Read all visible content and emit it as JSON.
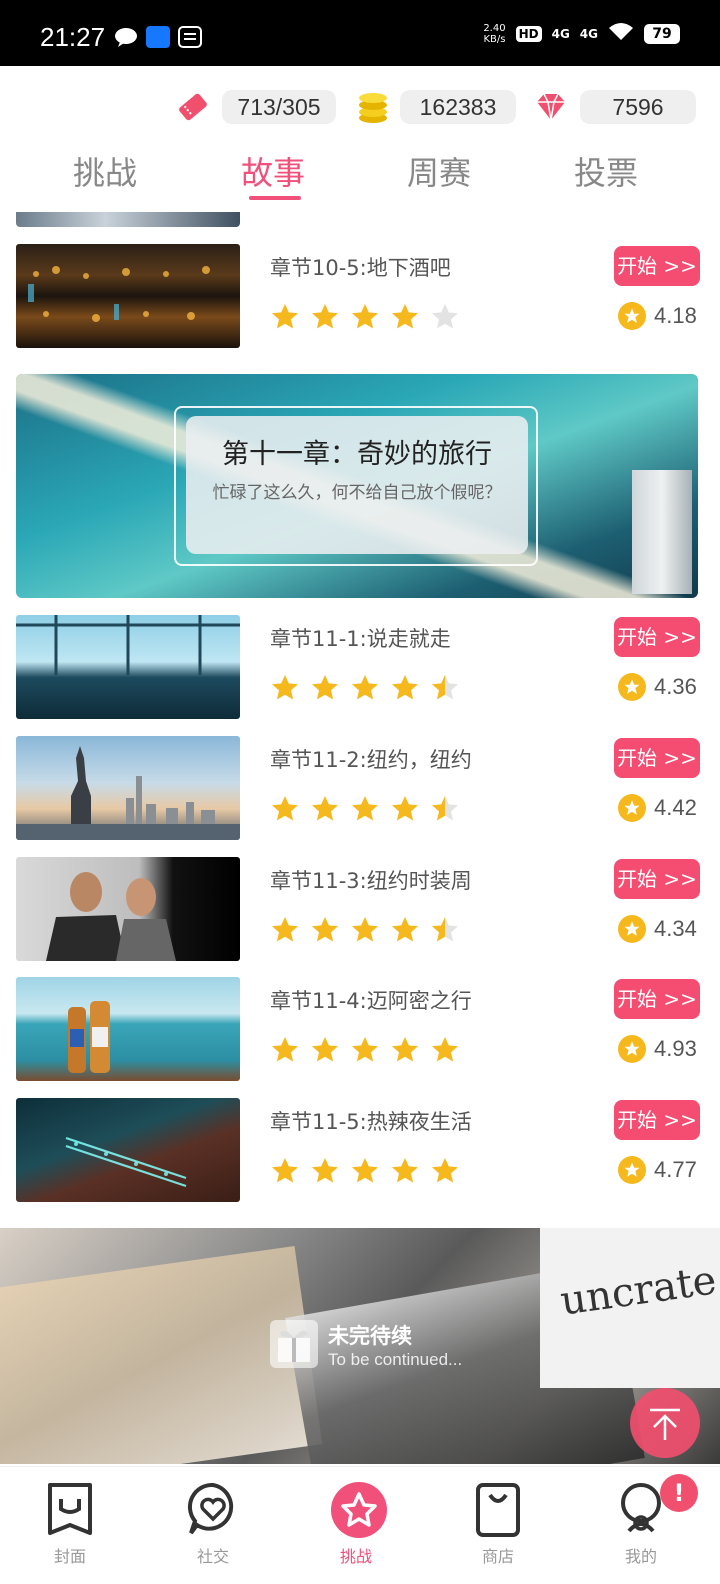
{
  "status_bar": {
    "time": "21:27",
    "net_speed_value": "2.40",
    "net_speed_unit": "KB/s",
    "hd_badge": "HD",
    "signal_1": "4G",
    "signal_2": "4G",
    "battery": "79"
  },
  "currencies": [
    {
      "icon": "ticket-icon",
      "value": "713/305"
    },
    {
      "icon": "coins-icon",
      "value": "162383"
    },
    {
      "icon": "diamond-icon",
      "value": "7596"
    }
  ],
  "tabs": [
    {
      "label": "挑战",
      "active": false
    },
    {
      "label": "故事",
      "active": true
    },
    {
      "label": "周赛",
      "active": false
    },
    {
      "label": "投票",
      "active": false
    }
  ],
  "chapters_top": [
    {
      "title": "章节10-5:地下酒吧",
      "stars": 4,
      "rating": "4.18",
      "button": "开始 >>"
    }
  ],
  "chapter_banner": {
    "title": "第十一章：奇妙的旅行",
    "subtitle": "忙碌了这么久，何不给自己放个假呢？"
  },
  "chapters": [
    {
      "title": "章节11-1:说走就走",
      "stars": 4.5,
      "rating": "4.36",
      "button": "开始 >>"
    },
    {
      "title": "章节11-2:纽约，纽约",
      "stars": 4.5,
      "rating": "4.42",
      "button": "开始 >>"
    },
    {
      "title": "章节11-3:纽约时装周",
      "stars": 4.5,
      "rating": "4.34",
      "button": "开始 >>"
    },
    {
      "title": "章节11-4:迈阿密之行",
      "stars": 5,
      "rating": "4.93",
      "button": "开始 >>"
    },
    {
      "title": "章节11-5:热辣夜生活",
      "stars": 5,
      "rating": "4.77",
      "button": "开始 >>"
    }
  ],
  "continued": {
    "title": "未完待续",
    "subtitle": "To be continued...",
    "magazine_text": "uncrate"
  },
  "bottom_nav": [
    {
      "label": "封面",
      "icon": "cover-icon",
      "active": false
    },
    {
      "label": "社交",
      "icon": "heart-chat-icon",
      "active": false
    },
    {
      "label": "挑战",
      "icon": "star-badge-icon",
      "active": true
    },
    {
      "label": "商店",
      "icon": "shopping-bag-icon",
      "active": false
    },
    {
      "label": "我的",
      "icon": "profile-icon",
      "active": false
    }
  ],
  "nav_badge": "!",
  "colors": {
    "accent": "#f0507a",
    "button": "#f54d72",
    "star": "#f5b91e"
  }
}
